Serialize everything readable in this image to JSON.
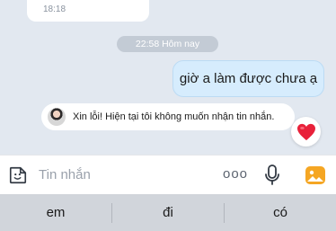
{
  "chat": {
    "previous_message_time": "18:18",
    "date_separator": "22:58 Hôm nay",
    "sent_message": "giờ a làm được chưa ạ",
    "system_notice": "Xin lỗi! Hiện tại tôi không muốn nhận tin nhắn.",
    "reaction_icon": "heart-icon",
    "reaction_color": "#e8213a"
  },
  "composer": {
    "placeholder": "Tin nhắn",
    "more_glyph": "ooo",
    "icons": [
      "sticker-icon",
      "more-icon",
      "microphone-icon",
      "image-icon"
    ],
    "image_icon_color": "#f5a623"
  },
  "keyboard": {
    "suggestions": [
      "em",
      "đi",
      "có"
    ]
  }
}
